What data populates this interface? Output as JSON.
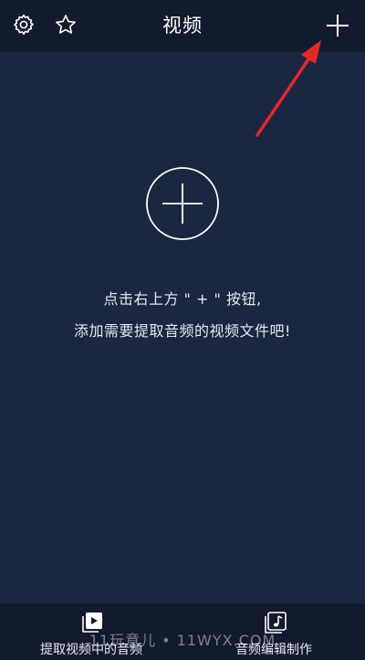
{
  "header": {
    "title": "视频",
    "icons": {
      "settings": "gear-icon",
      "favorite": "star-icon",
      "add": "plus-icon"
    }
  },
  "empty_state": {
    "line1": "点击右上方 \" + \" 按钮,",
    "line2": "添加需要提取音频的视频文件吧!"
  },
  "bottom_bar": {
    "tabs": [
      {
        "label": "提取视频中的音频",
        "icon": "video-play-icon"
      },
      {
        "label": "音频编辑制作",
        "icon": "music-note-icon"
      }
    ]
  },
  "watermark": "11玩意儿 • 11WYX.COM",
  "colors": {
    "background": "#1b2740",
    "bars": "#111a2e",
    "annotation": "#e02a2a"
  }
}
